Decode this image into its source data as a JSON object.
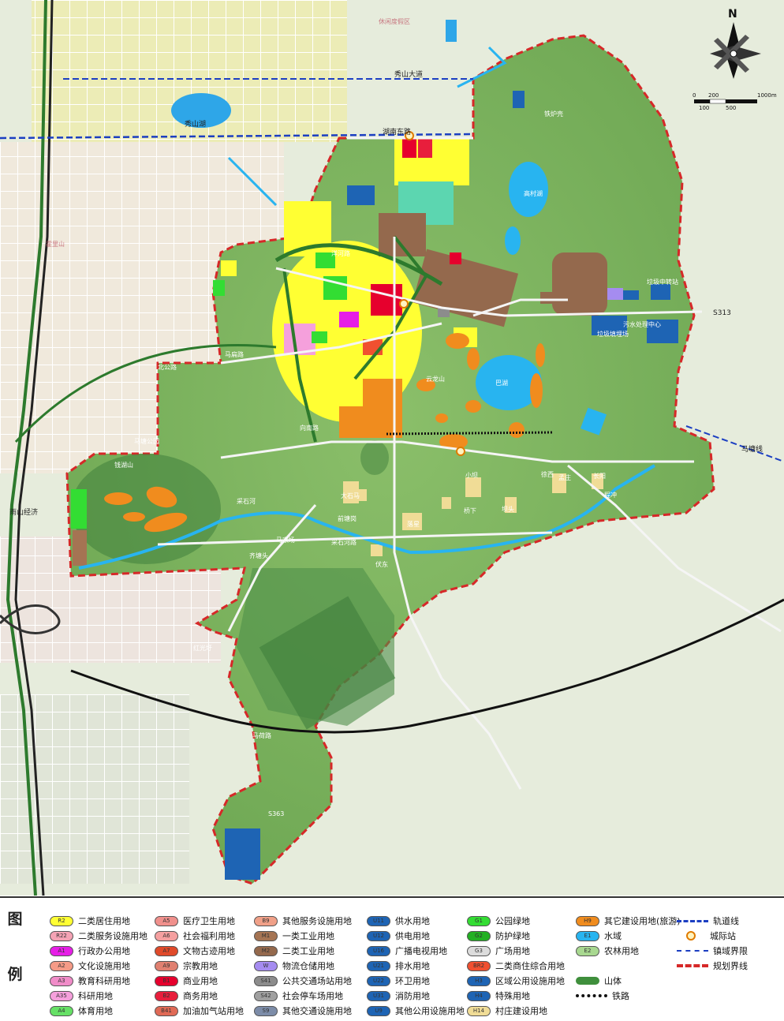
{
  "map": {
    "labels_base": [
      "休闲度假区",
      "秀山湖",
      "霍里山",
      "大"
    ],
    "roads": [
      "湖南东路",
      "秀山大道",
      "S313",
      "马塘线",
      "采石河路",
      "向南路",
      "马荷路",
      "S363",
      "采石河",
      "前进路",
      "泉河路",
      "江湖路",
      "北公路",
      "马扁路",
      "洋河路"
    ],
    "places": [
      "雨山经济",
      "马塘公园",
      "钱湖山",
      "九华山公园",
      "云龙山",
      "巴湖",
      "高村湖",
      "铁炉壳",
      "马家场",
      "齐塘头",
      "红光圩",
      "大石马",
      "前塘岗",
      "落星",
      "伏东",
      "小坝",
      "桥下",
      "坝头",
      "徐西",
      "孟庄",
      "长阳",
      "程冲",
      "垃圾中转站",
      "垃圾填埋场",
      "污水处理中心",
      "城际站"
    ],
    "scale": {
      "unit": "1000m",
      "ticks_top": [
        "0",
        "200",
        "1000m"
      ],
      "ticks_bottom": [
        "100",
        "500"
      ]
    },
    "north": "N"
  },
  "legend": {
    "title_top": "图",
    "title_bottom": "例",
    "items": [
      {
        "code": "R2",
        "label": "二类居住用地",
        "color": "#ffff33"
      },
      {
        "code": "R22",
        "label": "二类服务设施用地",
        "color": "#f5a3b5"
      },
      {
        "code": "A1",
        "label": "行政办公用地",
        "color": "#e61ee6"
      },
      {
        "code": "A2",
        "label": "文化设施用地",
        "color": "#f59b87"
      },
      {
        "code": "A3",
        "label": "教育科研用地",
        "color": "#f08cc8"
      },
      {
        "code": "A35",
        "label": "科研用地",
        "color": "#f5a0dc"
      },
      {
        "code": "A4",
        "label": "体育用地",
        "color": "#66e066"
      },
      {
        "code": "A5",
        "label": "医疗卫生用地",
        "color": "#f0908c"
      },
      {
        "code": "A6",
        "label": "社会福利用地",
        "color": "#f5a0a0"
      },
      {
        "code": "A7",
        "label": "文物古迹用地",
        "color": "#e04a2a"
      },
      {
        "code": "A9",
        "label": "宗教用地",
        "color": "#e08070"
      },
      {
        "code": "B1",
        "label": "商业用地",
        "color": "#e6002d"
      },
      {
        "code": "B2",
        "label": "商务用地",
        "color": "#e81e3c"
      },
      {
        "code": "B41",
        "label": "加油加气站用地",
        "color": "#e06a56"
      },
      {
        "code": "B9",
        "label": "其他服务设施用地",
        "color": "#f0a088"
      },
      {
        "code": "M1",
        "label": "一类工业用地",
        "color": "#a57453"
      },
      {
        "code": "M2",
        "label": "二类工业用地",
        "color": "#94694d"
      },
      {
        "code": "W",
        "label": "物流仓储用地",
        "color": "#a58cf0"
      },
      {
        "code": "S41",
        "label": "公共交通场站用地",
        "color": "#8c8c8c"
      },
      {
        "code": "S42",
        "label": "社会停车场用地",
        "color": "#a0a0a0"
      },
      {
        "code": "S9",
        "label": "其他交通设施用地",
        "color": "#7c8ca8"
      },
      {
        "code": "U11",
        "label": "供水用地",
        "color": "#1e64b4"
      },
      {
        "code": "U12",
        "label": "供电用地",
        "color": "#1e64b4"
      },
      {
        "code": "U16",
        "label": "广播电视用地",
        "color": "#1e64b4"
      },
      {
        "code": "U21",
        "label": "排水用地",
        "color": "#1e64b4"
      },
      {
        "code": "U22",
        "label": "环卫用地",
        "color": "#1e64b4"
      },
      {
        "code": "U31",
        "label": "消防用地",
        "color": "#1e64b4"
      },
      {
        "code": "U9",
        "label": "其他公用设施用地",
        "color": "#1e64b4"
      },
      {
        "code": "G1",
        "label": "公园绿地",
        "color": "#33dd33"
      },
      {
        "code": "G2",
        "label": "防护绿地",
        "color": "#22b022"
      },
      {
        "code": "G3",
        "label": "广场用地",
        "color": "#dcdcdc"
      },
      {
        "code": "BR2",
        "label": "二类商住综合用地",
        "color": "#f05030"
      },
      {
        "code": "H3",
        "label": "区域公用设施用地",
        "color": "#1e64b4"
      },
      {
        "code": "H4",
        "label": "特殊用地",
        "color": "#1e64b4"
      },
      {
        "code": "H14",
        "label": "村庄建设用地",
        "color": "#f0dc96"
      },
      {
        "code": "H9",
        "label": "其它建设用地(旅游)",
        "color": "#f08c1e"
      },
      {
        "code": "E1",
        "label": "水域",
        "color": "#28b4f0"
      },
      {
        "code": "E2",
        "label": "农林用地",
        "color": "#a8d890"
      }
    ],
    "line_items": [
      {
        "label": "山体",
        "kind": "mountain"
      },
      {
        "label": "铁路",
        "kind": "railway"
      },
      {
        "label": "轨道线",
        "kind": "metro"
      },
      {
        "label": "城际站",
        "kind": "station"
      },
      {
        "label": "镇域界限",
        "kind": "town-boundary"
      },
      {
        "label": "规划界线",
        "kind": "plan-boundary"
      }
    ]
  }
}
